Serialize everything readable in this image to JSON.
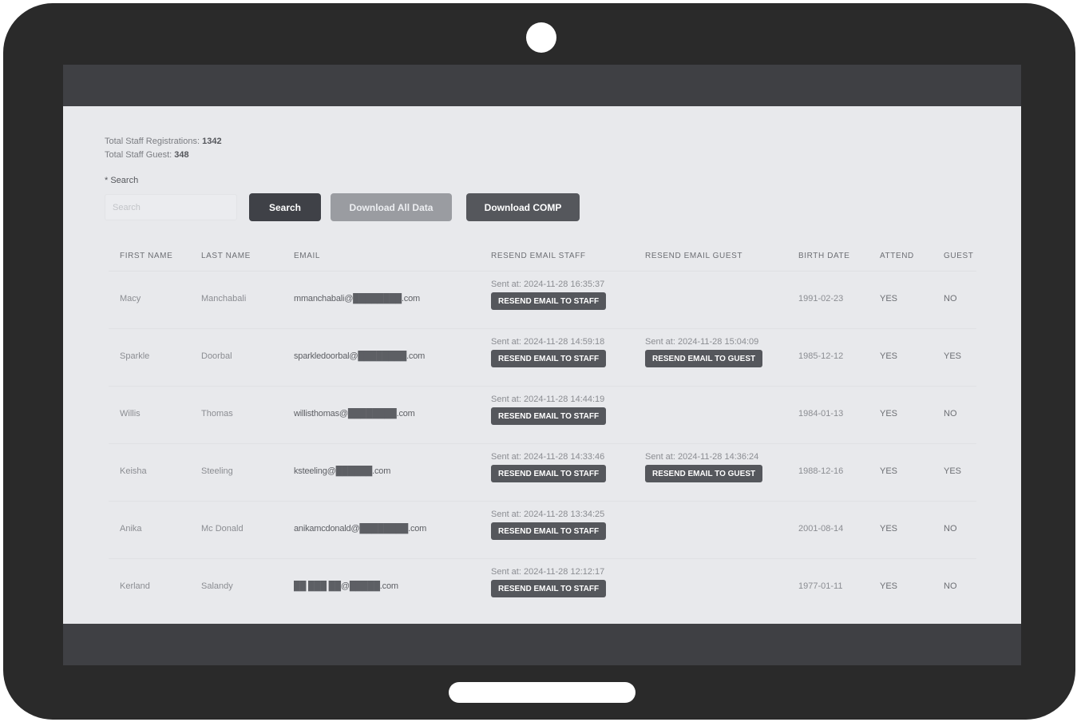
{
  "stats": {
    "registrations_label": "Total Staff Registrations:",
    "registrations_value": "1342",
    "guest_label": "Total Staff Guest:",
    "guest_value": "348"
  },
  "search": {
    "label": "* Search",
    "placeholder": "Search",
    "button": "Search"
  },
  "actions": {
    "download_all": "Download All Data",
    "download_comp": "Download COMP"
  },
  "table": {
    "headers": [
      "FIRST NAME",
      "LAST NAME",
      "EMAIL",
      "RESEND EMAIL STAFF",
      "RESEND EMAIL GUEST",
      "BIRTH DATE",
      "ATTEND",
      "GUEST"
    ],
    "resend_staff_label": "RESEND EMAIL TO STAFF",
    "resend_guest_label": "RESEND EMAIL TO GUEST",
    "rows": [
      {
        "first": "Macy",
        "last": "Manchabali",
        "email": "mmanchabali@████████.com",
        "staff_sent": "Sent at: 2024-11-28 16:35:37",
        "guest_sent": "",
        "birth": "1991-02-23",
        "attend": "YES",
        "guest": "NO"
      },
      {
        "first": "Sparkle",
        "last": "Doorbal",
        "email": "sparkledoorbal@████████.com",
        "staff_sent": "Sent at: 2024-11-28 14:59:18",
        "guest_sent": "Sent at: 2024-11-28 15:04:09",
        "birth": "1985-12-12",
        "attend": "YES",
        "guest": "YES"
      },
      {
        "first": "Willis",
        "last": "Thomas",
        "email": "willisthomas@████████.com",
        "staff_sent": "Sent at: 2024-11-28 14:44:19",
        "guest_sent": "",
        "birth": "1984-01-13",
        "attend": "YES",
        "guest": "NO"
      },
      {
        "first": "Keisha",
        "last": "Steeling",
        "email": "ksteeling@██████.com",
        "staff_sent": "Sent at: 2024-11-28 14:33:46",
        "guest_sent": "Sent at: 2024-11-28 14:36:24",
        "birth": "1988-12-16",
        "attend": "YES",
        "guest": "YES"
      },
      {
        "first": "Anika",
        "last": "Mc Donald",
        "email": "anikamcdonald@████████.com",
        "staff_sent": "Sent at: 2024-11-28 13:34:25",
        "guest_sent": "",
        "birth": "2001-08-14",
        "attend": "YES",
        "guest": "NO"
      },
      {
        "first": "Kerland",
        "last": "Salandy",
        "email": "██ ███ ██@█████.com",
        "staff_sent": "Sent at: 2024-11-28 12:12:17",
        "guest_sent": "",
        "birth": "1977-01-11",
        "attend": "YES",
        "guest": "NO"
      }
    ]
  }
}
